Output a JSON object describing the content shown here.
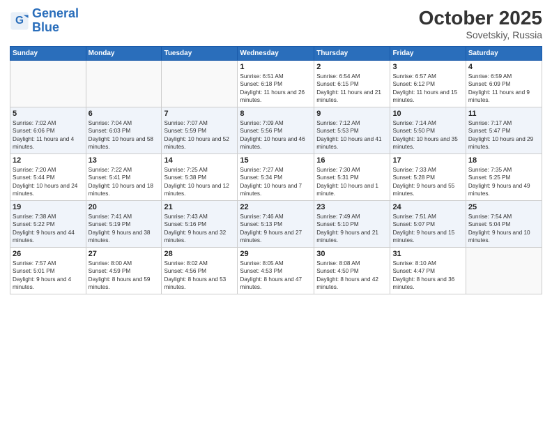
{
  "header": {
    "logo_line1": "General",
    "logo_line2": "Blue",
    "month": "October 2025",
    "location": "Sovetskiy, Russia"
  },
  "weekdays": [
    "Sunday",
    "Monday",
    "Tuesday",
    "Wednesday",
    "Thursday",
    "Friday",
    "Saturday"
  ],
  "weeks": [
    [
      {
        "day": "",
        "info": ""
      },
      {
        "day": "",
        "info": ""
      },
      {
        "day": "",
        "info": ""
      },
      {
        "day": "1",
        "info": "Sunrise: 6:51 AM\nSunset: 6:18 PM\nDaylight: 11 hours and 26 minutes."
      },
      {
        "day": "2",
        "info": "Sunrise: 6:54 AM\nSunset: 6:15 PM\nDaylight: 11 hours and 21 minutes."
      },
      {
        "day": "3",
        "info": "Sunrise: 6:57 AM\nSunset: 6:12 PM\nDaylight: 11 hours and 15 minutes."
      },
      {
        "day": "4",
        "info": "Sunrise: 6:59 AM\nSunset: 6:09 PM\nDaylight: 11 hours and 9 minutes."
      }
    ],
    [
      {
        "day": "5",
        "info": "Sunrise: 7:02 AM\nSunset: 6:06 PM\nDaylight: 11 hours and 4 minutes."
      },
      {
        "day": "6",
        "info": "Sunrise: 7:04 AM\nSunset: 6:03 PM\nDaylight: 10 hours and 58 minutes."
      },
      {
        "day": "7",
        "info": "Sunrise: 7:07 AM\nSunset: 5:59 PM\nDaylight: 10 hours and 52 minutes."
      },
      {
        "day": "8",
        "info": "Sunrise: 7:09 AM\nSunset: 5:56 PM\nDaylight: 10 hours and 46 minutes."
      },
      {
        "day": "9",
        "info": "Sunrise: 7:12 AM\nSunset: 5:53 PM\nDaylight: 10 hours and 41 minutes."
      },
      {
        "day": "10",
        "info": "Sunrise: 7:14 AM\nSunset: 5:50 PM\nDaylight: 10 hours and 35 minutes."
      },
      {
        "day": "11",
        "info": "Sunrise: 7:17 AM\nSunset: 5:47 PM\nDaylight: 10 hours and 29 minutes."
      }
    ],
    [
      {
        "day": "12",
        "info": "Sunrise: 7:20 AM\nSunset: 5:44 PM\nDaylight: 10 hours and 24 minutes."
      },
      {
        "day": "13",
        "info": "Sunrise: 7:22 AM\nSunset: 5:41 PM\nDaylight: 10 hours and 18 minutes."
      },
      {
        "day": "14",
        "info": "Sunrise: 7:25 AM\nSunset: 5:38 PM\nDaylight: 10 hours and 12 minutes."
      },
      {
        "day": "15",
        "info": "Sunrise: 7:27 AM\nSunset: 5:34 PM\nDaylight: 10 hours and 7 minutes."
      },
      {
        "day": "16",
        "info": "Sunrise: 7:30 AM\nSunset: 5:31 PM\nDaylight: 10 hours and 1 minute."
      },
      {
        "day": "17",
        "info": "Sunrise: 7:33 AM\nSunset: 5:28 PM\nDaylight: 9 hours and 55 minutes."
      },
      {
        "day": "18",
        "info": "Sunrise: 7:35 AM\nSunset: 5:25 PM\nDaylight: 9 hours and 49 minutes."
      }
    ],
    [
      {
        "day": "19",
        "info": "Sunrise: 7:38 AM\nSunset: 5:22 PM\nDaylight: 9 hours and 44 minutes."
      },
      {
        "day": "20",
        "info": "Sunrise: 7:41 AM\nSunset: 5:19 PM\nDaylight: 9 hours and 38 minutes."
      },
      {
        "day": "21",
        "info": "Sunrise: 7:43 AM\nSunset: 5:16 PM\nDaylight: 9 hours and 32 minutes."
      },
      {
        "day": "22",
        "info": "Sunrise: 7:46 AM\nSunset: 5:13 PM\nDaylight: 9 hours and 27 minutes."
      },
      {
        "day": "23",
        "info": "Sunrise: 7:49 AM\nSunset: 5:10 PM\nDaylight: 9 hours and 21 minutes."
      },
      {
        "day": "24",
        "info": "Sunrise: 7:51 AM\nSunset: 5:07 PM\nDaylight: 9 hours and 15 minutes."
      },
      {
        "day": "25",
        "info": "Sunrise: 7:54 AM\nSunset: 5:04 PM\nDaylight: 9 hours and 10 minutes."
      }
    ],
    [
      {
        "day": "26",
        "info": "Sunrise: 7:57 AM\nSunset: 5:01 PM\nDaylight: 9 hours and 4 minutes."
      },
      {
        "day": "27",
        "info": "Sunrise: 8:00 AM\nSunset: 4:59 PM\nDaylight: 8 hours and 59 minutes."
      },
      {
        "day": "28",
        "info": "Sunrise: 8:02 AM\nSunset: 4:56 PM\nDaylight: 8 hours and 53 minutes."
      },
      {
        "day": "29",
        "info": "Sunrise: 8:05 AM\nSunset: 4:53 PM\nDaylight: 8 hours and 47 minutes."
      },
      {
        "day": "30",
        "info": "Sunrise: 8:08 AM\nSunset: 4:50 PM\nDaylight: 8 hours and 42 minutes."
      },
      {
        "day": "31",
        "info": "Sunrise: 8:10 AM\nSunset: 4:47 PM\nDaylight: 8 hours and 36 minutes."
      },
      {
        "day": "",
        "info": ""
      }
    ]
  ]
}
